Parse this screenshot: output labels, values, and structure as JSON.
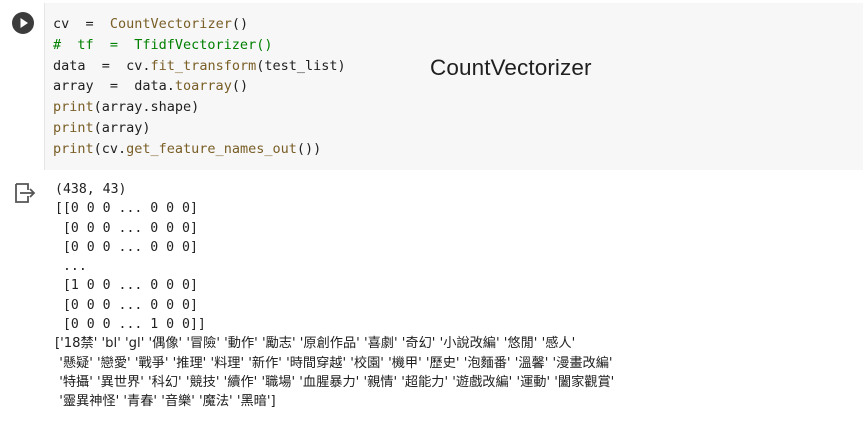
{
  "code_cell": {
    "run_button_icon": "play-circle-icon",
    "lines": [
      "cv  =  CountVectorizer()",
      "#  tf  =  TfidfVectorizer()",
      "data  =  cv.fit_transform(test_list)",
      "array  =  data.toarray()",
      "print(array.shape)",
      "print(array)",
      "print(cv.get_feature_names_out())"
    ]
  },
  "caption": "CountVectorizer",
  "output_cell": {
    "output_icon": "output-redirect-icon",
    "lines": [
      "(438, 43)",
      "[[0 0 0 ... 0 0 0]",
      " [0 0 0 ... 0 0 0]",
      " [0 0 0 ... 0 0 0]",
      " ...",
      " [1 0 0 ... 0 0 0]",
      " [0 0 0 ... 0 0 0]",
      " [0 0 0 ... 1 0 0]]",
      "['18禁' 'bl' 'gl' '偶像' '冒險' '動作' '勵志' '原創作品' '喜劇' '奇幻' '小說改編' '悠閒' '感人'",
      " '懸疑' '戀愛' '戰爭' '推理' '料理' '新作' '時間穿越' '校園' '機甲' '歷史' '泡麵番' '溫馨' '漫畫改編'",
      " '特攝' '異世界' '科幻' '競技' '續作' '職場' '血腥暴力' '親情' '超能力' '遊戲改編' '運動' '闔家觀賞'",
      " '靈異神怪' '青春' '音樂' '魔法' '黑暗']"
    ]
  },
  "colors": {
    "editor_background": "#f7f7f7",
    "function_color": "#795e26",
    "comment_color": "#008000",
    "text_color": "#1f1f1f",
    "run_button_color": "#3c3c3c"
  }
}
